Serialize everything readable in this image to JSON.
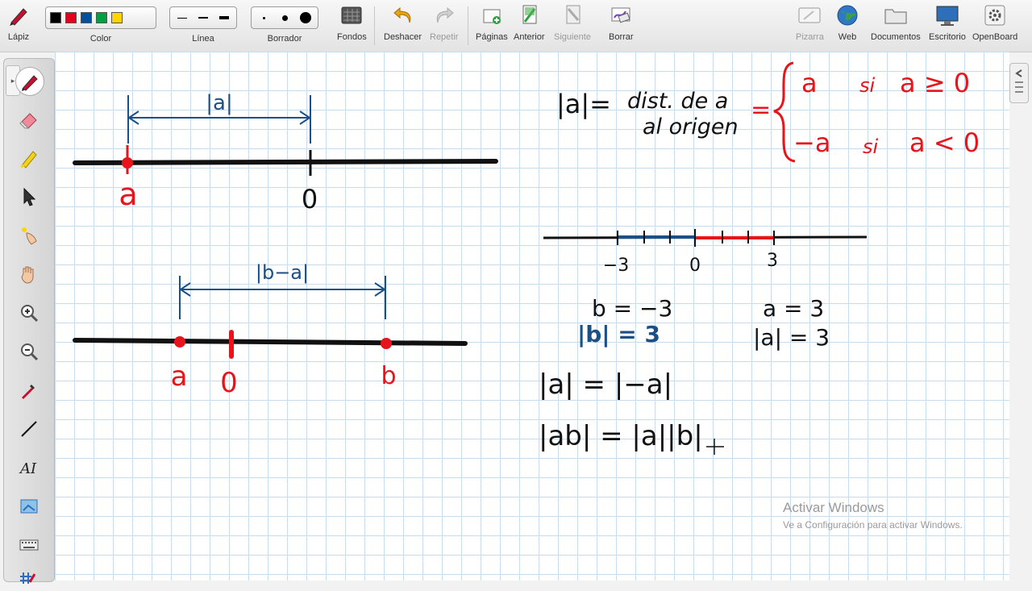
{
  "toolbar": {
    "pen": "Lápiz",
    "color": "Color",
    "line": "Línea",
    "eraser": "Borrador",
    "backgrounds": "Fondos",
    "undo": "Deshacer",
    "redo": "Repetir",
    "pages": "Páginas",
    "previous": "Anterior",
    "next": "Siguiente",
    "clear": "Borrar",
    "board": "Pizarra",
    "web": "Web",
    "documents": "Documentos",
    "desktop": "Escritorio",
    "openboard": "OpenBoard"
  },
  "colors": {
    "swatches": [
      "#000000",
      "#e5001b",
      "#0050a0",
      "#00a040",
      "#ffd400"
    ],
    "ink_black": "#000000",
    "ink_red": "#e8141c",
    "ink_blue": "#1a4f87",
    "grid": "#c7dced"
  },
  "palette_tools": [
    "pen-icon",
    "eraser-icon",
    "highlighter-icon",
    "pointer-icon",
    "laser-icon",
    "hand-icon",
    "zoom-in-icon",
    "zoom-out-icon",
    "color-picker-icon",
    "line-tool-icon",
    "text-tool-icon",
    "capture-icon",
    "keyboard-icon",
    "grid-icon"
  ],
  "board": {
    "diagram1": {
      "distance_label": "|a|",
      "point_a": "a",
      "point_zero": "0"
    },
    "diagram2": {
      "distance_label": "|b−a|",
      "point_a": "a",
      "point_zero": "0",
      "point_b": "b"
    },
    "definition": {
      "lhs": "|a|=",
      "text_line1": "dist. de a",
      "text_line2": "al origen",
      "equals": "=",
      "case1_value": "a",
      "case1_si": "si",
      "case1_cond": "a ≥ 0",
      "case2_value": "−a",
      "case2_si": "si",
      "case2_cond": "a < 0"
    },
    "numberline": {
      "tick_neg3": "−3",
      "tick_0": "0",
      "tick_3": "3"
    },
    "example_b_eq": "b = −3",
    "example_b_abs": "|b| = 3",
    "example_a_eq": "a = 3",
    "example_a_abs": "|a| = 3",
    "property1": "|a| = |−a|",
    "property2": "|ab| = |a||b|"
  },
  "watermark": {
    "line1": "Activar Windows",
    "line2": "Ve a Configuración para activar Windows."
  }
}
